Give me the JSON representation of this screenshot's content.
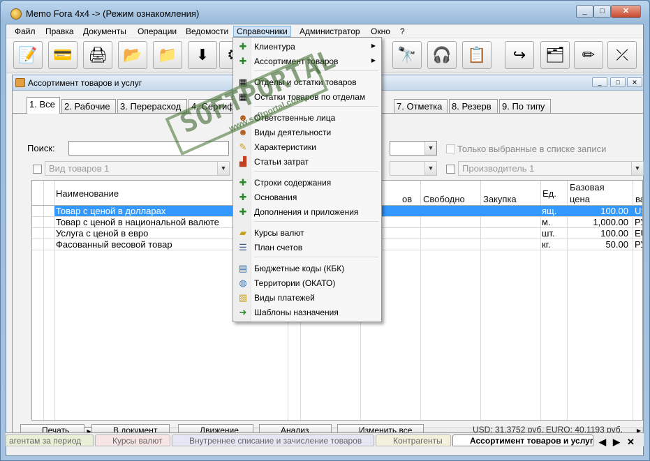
{
  "window": {
    "title": "Memo Fora 4x4 -> (Режим ознакомления)",
    "controls": [
      "_",
      "□",
      "✕"
    ]
  },
  "menubar": [
    "Файл",
    "Правка",
    "Документы",
    "Операции",
    "Ведомости",
    "Справочники",
    "Администратор",
    "Окно",
    "?"
  ],
  "toolbar_icons": [
    "edit-icon",
    "card-icon",
    "cash-register-icon",
    "folder-add-icon",
    "folder-open-icon",
    "download-icon",
    "hidden-icon",
    "binoculars-icon",
    "headset-icon",
    "note-icon",
    "forward-icon",
    "folder-blue-icon",
    "pencil-icon",
    "exit-icon"
  ],
  "inner_window": {
    "title": "Ассортимент товаров и услуг",
    "tabs": [
      "1. Все",
      "2. Рабочие",
      "3. Перерасход",
      "4. Сертиф",
      "7. Отметка",
      "8. Резерв",
      "9. По типу"
    ],
    "search_label": "Поиск:",
    "only_selected_label": "Только выбранные в списке записи",
    "goods_type_placeholder": "Вид товаров 1",
    "producer_placeholder": "Производитель 1"
  },
  "grid": {
    "headers": {
      "name": "Наименование",
      "vov": "ов",
      "free": "Свободно",
      "purchase": "Закупка",
      "unit": "Ед.",
      "base": "Базовая",
      "price": "цена",
      "currency": "ва"
    },
    "rows": [
      {
        "name": "Товар с ценой в долларах",
        "unit": "ящ.",
        "price": "100.00",
        "currency": "US"
      },
      {
        "name": "Товар с ценой в национальной валюте",
        "unit": "м.",
        "price": "1,000.00",
        "currency": "РУ"
      },
      {
        "name": "Услуга с ценой в евро",
        "unit": "шт.",
        "price": "100.00",
        "currency": "EU"
      },
      {
        "name": "Фасованный весовой товар",
        "unit": "кг.",
        "price": "50.00",
        "currency": "РУ"
      }
    ]
  },
  "nav_buttons": [
    "|◀",
    "◀◀",
    "◀",
    "?",
    "▶",
    "▶▶",
    "▶|",
    "◀",
    "▶"
  ],
  "bottom": {
    "buttons": [
      "Печать",
      "В документ",
      "Движение",
      "Анализ",
      "Изменить все"
    ],
    "status": "USD: 31.3752 руб.   EURO: 40.1193 руб."
  },
  "taskbar": {
    "tasks": [
      "агентам за период",
      "Курсы валют",
      "Внутреннее списание и зачисление товаров",
      "Контрагенты",
      "Ассортимент товаров и услуг"
    ],
    "nav": [
      "◀",
      "▶",
      "✕"
    ]
  },
  "dropdown": {
    "items": [
      {
        "label": "Клиентура",
        "icon": "plus-icon",
        "submenu": true
      },
      {
        "label": "Ассортимент товаров",
        "icon": "plus-icon",
        "submenu": true
      },
      {
        "label": "Отделы и остатки товаров",
        "icon": "hidden-icon",
        "submenu": false
      },
      {
        "label": "Остатки товаров по отделам",
        "icon": "hidden-icon",
        "submenu": false
      },
      {
        "label": "Ответственные лица",
        "icon": "person-icon",
        "submenu": false
      },
      {
        "label": "Виды деятельности",
        "icon": "person-icon",
        "submenu": false
      },
      {
        "label": "Характеристики",
        "icon": "pencil-icon",
        "submenu": false
      },
      {
        "label": "Статьи затрат",
        "icon": "chart-icon",
        "submenu": false
      },
      {
        "label": "Строки содержания",
        "icon": "plus-icon",
        "submenu": false
      },
      {
        "label": "Основания",
        "icon": "plus-icon",
        "submenu": false
      },
      {
        "label": "Дополнения и приложения",
        "icon": "plus-icon",
        "submenu": false
      },
      {
        "label": "Курсы валют",
        "icon": "folder-icon",
        "submenu": false
      },
      {
        "label": "План счетов",
        "icon": "list-icon",
        "submenu": false
      },
      {
        "label": "Бюджетные коды (КБК)",
        "icon": "document-icon",
        "submenu": false
      },
      {
        "label": "Территории (ОКАТО)",
        "icon": "globe-icon",
        "submenu": false
      },
      {
        "label": "Виды платежей",
        "icon": "receipt-icon",
        "submenu": false
      },
      {
        "label": "Шаблоны назначения",
        "icon": "arrow-icon",
        "submenu": false
      }
    ]
  },
  "watermark": {
    "big": "SOFTPORTAL",
    "small": "www.softportal.com"
  }
}
